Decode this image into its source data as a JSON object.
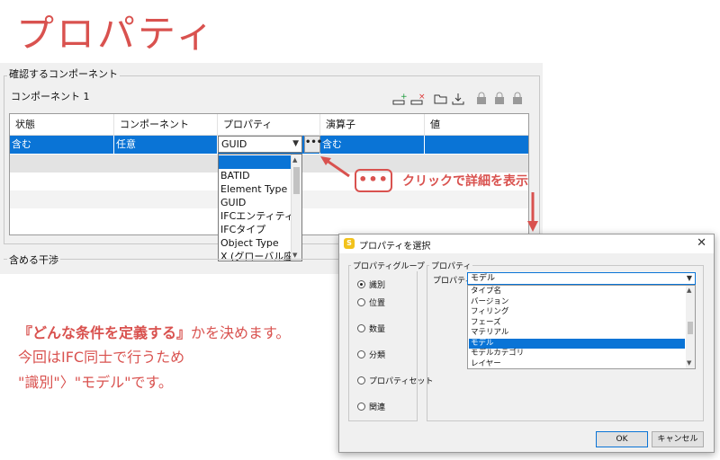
{
  "page": {
    "title": "プロパティ"
  },
  "panel": {
    "group_caption": "確認するコンポーネント",
    "component_label": "コンポーネント 1",
    "interference_caption": "含める干渉"
  },
  "table": {
    "headers": [
      "状態",
      "コンポーネント",
      "プロパティ",
      "演算子",
      "値"
    ],
    "row": {
      "status": "含む",
      "component": "任意",
      "property": "GUID",
      "operator": "含む",
      "value": ""
    }
  },
  "dropdown": {
    "items": [
      "",
      "BATID",
      "Element Type",
      "GUID",
      "IFCエンティティ",
      "IFCタイプ",
      "Object Type",
      "X (グローバル座標"
    ]
  },
  "callout": {
    "dots": "•••",
    "text": "クリックで詳細を表示"
  },
  "body": {
    "line1_emph": "『どんな条件を定義する』",
    "line1_rest": "かを決めます。",
    "line2": "今回はIFC同士で行うため",
    "line3": "\"識別\"〉\"モデル\"です。"
  },
  "dialog": {
    "title": "プロパティを選択",
    "group_caption": "プロパティグループ",
    "property_group_caption": "プロパティ",
    "property_label": "プロパティ",
    "radio_options": [
      "識別",
      "位置",
      "数量",
      "分類",
      "プロパティセット",
      "関連"
    ],
    "selected_radio": "識別",
    "combo_value": "モデル",
    "list_items": [
      "タイプ名",
      "バージョン",
      "フィリング",
      "フェーズ",
      "マテリアル",
      "モデル",
      "モデルカテゴリ",
      "レイヤー"
    ],
    "selected_item": "モデル",
    "ok_label": "OK",
    "cancel_label": "キャンセル"
  },
  "colors": {
    "accent": "#d9524f",
    "selection": "#0a74d6"
  }
}
